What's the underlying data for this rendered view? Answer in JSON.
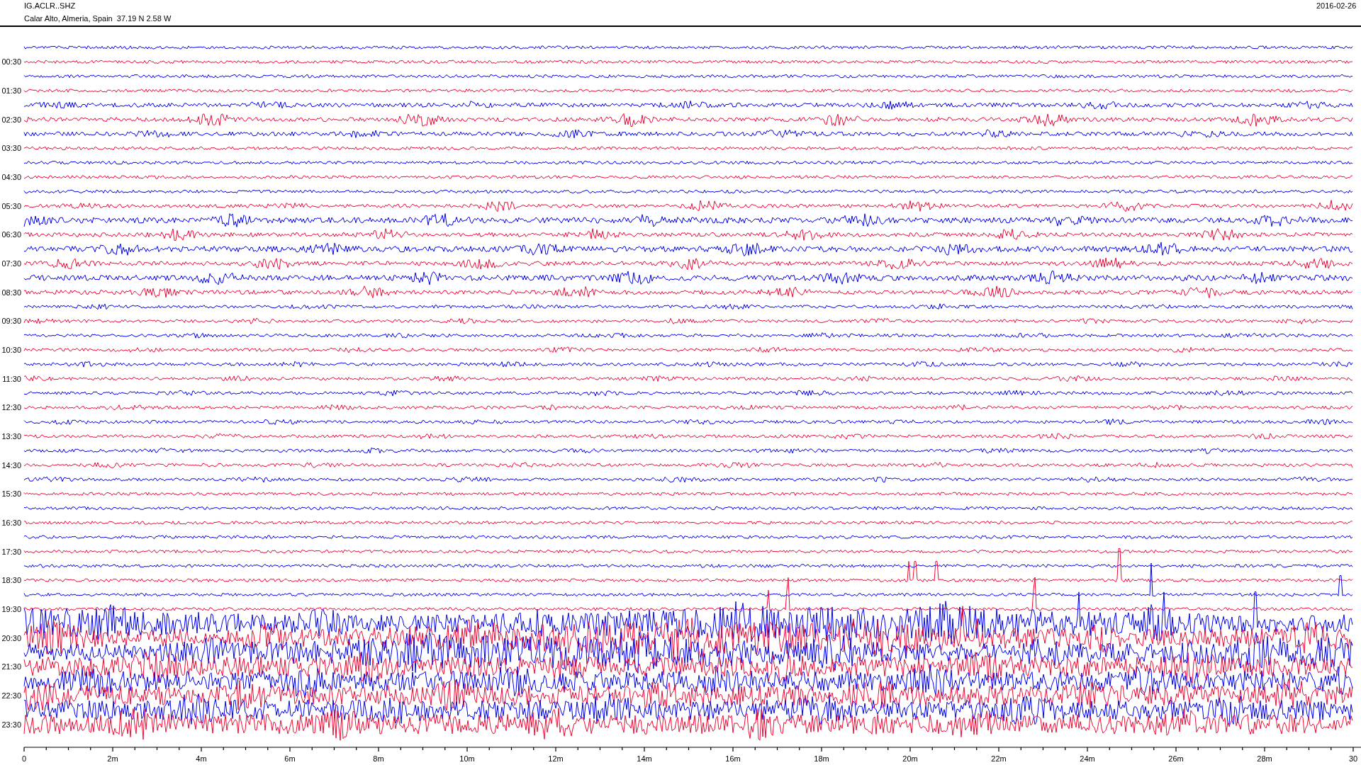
{
  "header": {
    "station": "IG.ACLR..SHZ",
    "location": "Calar Alto, Almeria, Spain  37.19 N 2.58 W",
    "date": "2016-02-26"
  },
  "row_labels": [
    "00:30",
    "01:30",
    "02:30",
    "03:30",
    "04:30",
    "05:30",
    "06:30",
    "07:30",
    "08:30",
    "09:30",
    "10:30",
    "11:30",
    "12:30",
    "13:30",
    "14:30",
    "15:30",
    "16:30",
    "17:30",
    "18:30",
    "19:30",
    "20:30",
    "21:30",
    "22:30",
    "23:30"
  ],
  "time_axis": {
    "tick_labels": [
      "0",
      "2m",
      "4m",
      "6m",
      "8m",
      "10m",
      "12m",
      "14m",
      "16m",
      "18m",
      "20m",
      "22m",
      "24m",
      "26m",
      "28m",
      "30"
    ]
  }
}
